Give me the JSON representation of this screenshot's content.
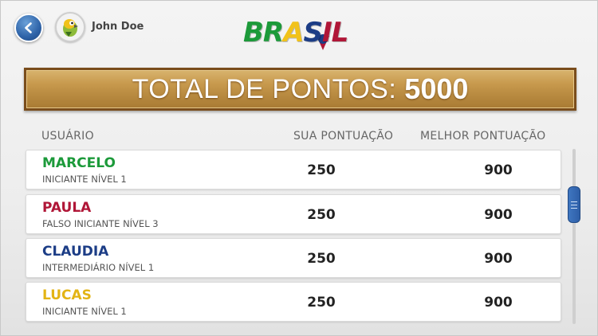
{
  "header": {
    "user_name": "John Doe",
    "logo_text": "BRASIL"
  },
  "banner": {
    "label": "TOTAL DE PONTOS:",
    "value": "5000"
  },
  "columns": {
    "user": "USUÁRIO",
    "your_score": "SUA PONTUAÇÃO",
    "best_score": "MELHOR PONTUAÇÃO"
  },
  "rows": [
    {
      "name": "MARCELO",
      "level": "INICIANTE NÍVEL 1",
      "score": "250",
      "best": "900",
      "color": "#1c9a3a"
    },
    {
      "name": "PAULA",
      "level": "FALSO INICIANTE NÍVEL 3",
      "score": "250",
      "best": "900",
      "color": "#b01637"
    },
    {
      "name": "CLAUDIA",
      "level": "INTERMEDIÁRIO NÍVEL 1",
      "score": "250",
      "best": "900",
      "color": "#1c3d86"
    },
    {
      "name": "LUCAS",
      "level": "INICIANTE NÍVEL 1",
      "score": "250",
      "best": "900",
      "color": "#e3b414"
    }
  ],
  "colors": {
    "accent_blue": "#2e63a8",
    "banner_gold": "#c89a4e"
  },
  "icons": {
    "back": "chevron-left-icon",
    "avatar": "parrot-avatar-icon"
  }
}
